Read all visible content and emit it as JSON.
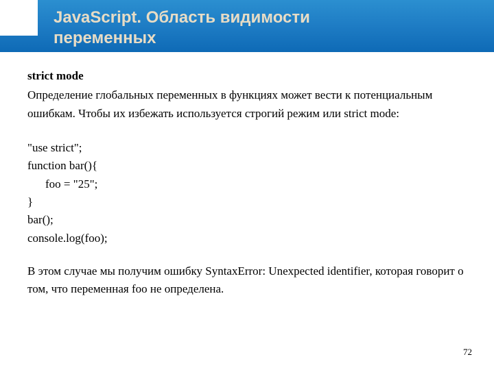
{
  "header": {
    "title_line1": "JavaScript. Область видимости",
    "title_line2": "переменных"
  },
  "content": {
    "subtitle": "strict mode",
    "intro": "Определение глобальных переменных в функциях может вести к потенциальным ошибкам. Чтобы их избежать используется строгий режим или strict mode:",
    "code": {
      "l1": "\"use strict\";",
      "l2": "function bar(){",
      "l3": "foo = \"25\";",
      "l4": "}",
      "l5": "bar();",
      "l6": "console.log(foo);"
    },
    "outro": "В этом случае мы получим ошибку SyntaxError: Unexpected identifier, которая говорит о том, что переменная foo не определена."
  },
  "page_number": "72"
}
